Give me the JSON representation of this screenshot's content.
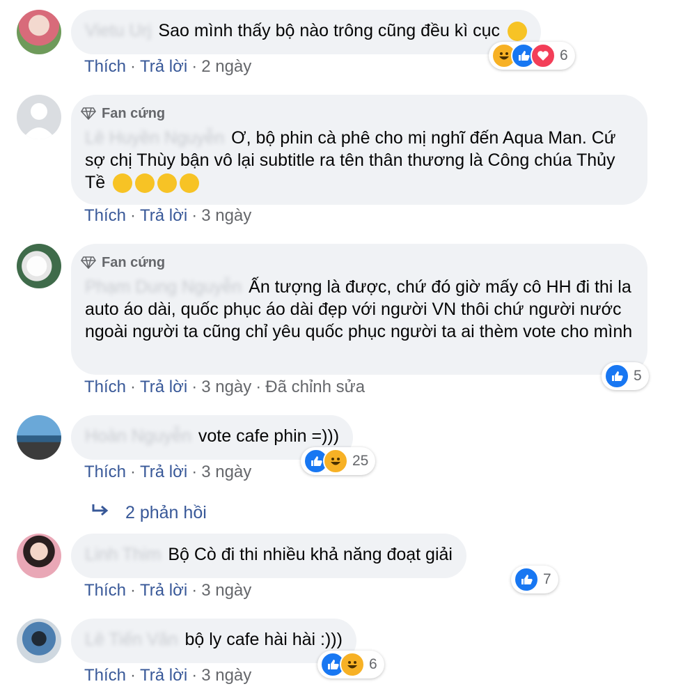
{
  "comments": [
    {
      "name": "Vietu Urj",
      "text": "Sao mình thấy bộ nào trông cũng đều kì cục",
      "actions": {
        "like": "Thích",
        "reply": "Trả lời",
        "time": "2 ngày"
      },
      "reactions": {
        "count": "6",
        "icons": [
          "haha-icon",
          "like-icon",
          "love-icon"
        ]
      }
    },
    {
      "badge": "Fan cứng",
      "name": "Lê Huyền Nguyễn",
      "text": "Ơ, bộ phin cà phê cho mị nghĩ đến Aqua Man. Cứ sợ chị Thùy bận vô lại subtitle ra tên thân thương là Công chúa Thủy Tề",
      "actions": {
        "like": "Thích",
        "reply": "Trả lời",
        "time": "3 ngày"
      }
    },
    {
      "badge": "Fan cứng",
      "name": "Phạm Dung Nguyễn",
      "text": "Ấn tượng là được, chứ đó giờ mấy cô HH đi thi la auto áo dài, quốc phục áo dài đẹp với người VN thôi chứ người nước ngoài người ta cũng chỉ yêu quốc phục người ta ai thèm vote cho mình",
      "actions": {
        "like": "Thích",
        "reply": "Trả lời",
        "time": "3 ngày",
        "edited": "Đã chỉnh sửa"
      },
      "reactions": {
        "count": "5",
        "icons": [
          "like-icon"
        ]
      }
    },
    {
      "name": "Hoàn Nguyễn",
      "text": "vote cafe phin =)))",
      "actions": {
        "like": "Thích",
        "reply": "Trả lời",
        "time": "3 ngày"
      },
      "reactions": {
        "count": "25",
        "icons": [
          "like-icon",
          "haha-icon"
        ]
      }
    },
    {
      "name": "Linh Thim",
      "text": "Bộ Cò đi thi nhiều khả năng đoạt giải",
      "actions": {
        "like": "Thích",
        "reply": "Trả lời",
        "time": "3 ngày"
      },
      "reactions": {
        "count": "7",
        "icons": [
          "like-icon"
        ]
      }
    },
    {
      "name": "Lê Tiến Văn",
      "text": "bộ ly cafe hài hài :)))",
      "actions": {
        "like": "Thích",
        "reply": "Trả lời",
        "time": "3 ngày"
      },
      "reactions": {
        "count": "6",
        "icons": [
          "like-icon",
          "haha-icon"
        ]
      }
    }
  ],
  "replies_link": "2 phản hồi",
  "colors": {
    "link": "#385898",
    "bubble": "#f0f2f5",
    "like": "#1877f2",
    "love": "#f33e58",
    "haha": "#f7b125"
  }
}
